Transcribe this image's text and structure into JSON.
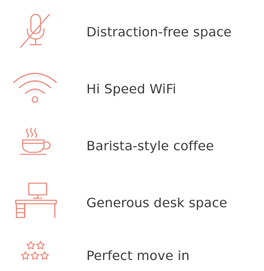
{
  "accent_color": "#e8897c",
  "text_color": "#3d3d3d",
  "features": [
    {
      "icon": "microphone-muted-icon",
      "label": "Distraction-free space"
    },
    {
      "icon": "wifi-icon",
      "label": "Hi Speed WiFi"
    },
    {
      "icon": "coffee-cup-icon",
      "label": "Barista-style coffee"
    },
    {
      "icon": "desk-icon",
      "label": "Generous desk space"
    },
    {
      "icon": "stars-icon",
      "label": "Perfect move in"
    }
  ]
}
